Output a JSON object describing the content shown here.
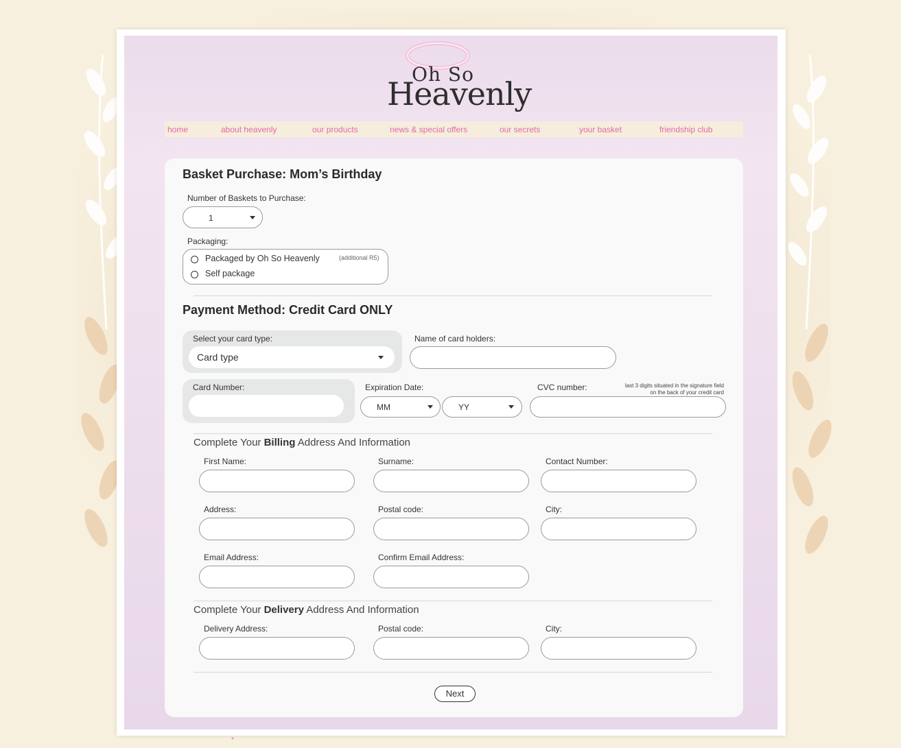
{
  "brand": {
    "line1": "Oh So",
    "line2": "Heavenly"
  },
  "nav": [
    "home",
    "about heavenly",
    "our products",
    "news & special offers",
    "our secrets",
    "your basket",
    "friendship club"
  ],
  "basket": {
    "title": "Basket Purchase: Mom’s Birthday",
    "qty_label": "Number of Baskets to Purchase:",
    "qty_value": "1",
    "packaging_label": "Packaging:",
    "option1": "Packaged by Oh So Heavenly",
    "option1_note": "(additional R5)",
    "option2": "Self package"
  },
  "payment": {
    "title": "Payment Method: Credit Card ONLY",
    "card_type_label": "Select your card type:",
    "card_type_value": "Card type",
    "holder_label": "Name of card holders:",
    "card_number_label": "Card Number:",
    "expiry_label": "Expiration Date:",
    "month": "MM",
    "year": "YY",
    "cvc_label": "CVC number:",
    "cvc_hint_1": "last 3 digits situated in the signature field",
    "cvc_hint_2": "on the back of your credit card"
  },
  "billing": {
    "title_pre": "Complete Your ",
    "title_bold": "Billing",
    "title_post": " Address And Information",
    "first_name": "First Name:",
    "surname": "Surname:",
    "contact": "Contact Number:",
    "address": "Address:",
    "postal": "Postal code:",
    "city": "City:",
    "email": "Email Address:",
    "confirm_email": "Confirm Email Address:"
  },
  "delivery": {
    "title_pre": "Complete Your ",
    "title_bold": "Delivery",
    "title_post": " Address And Information",
    "address": "Delivery Address:",
    "postal": "Postal code:",
    "city": "City:"
  },
  "next_label": "Next",
  "footer_mark": "*"
}
